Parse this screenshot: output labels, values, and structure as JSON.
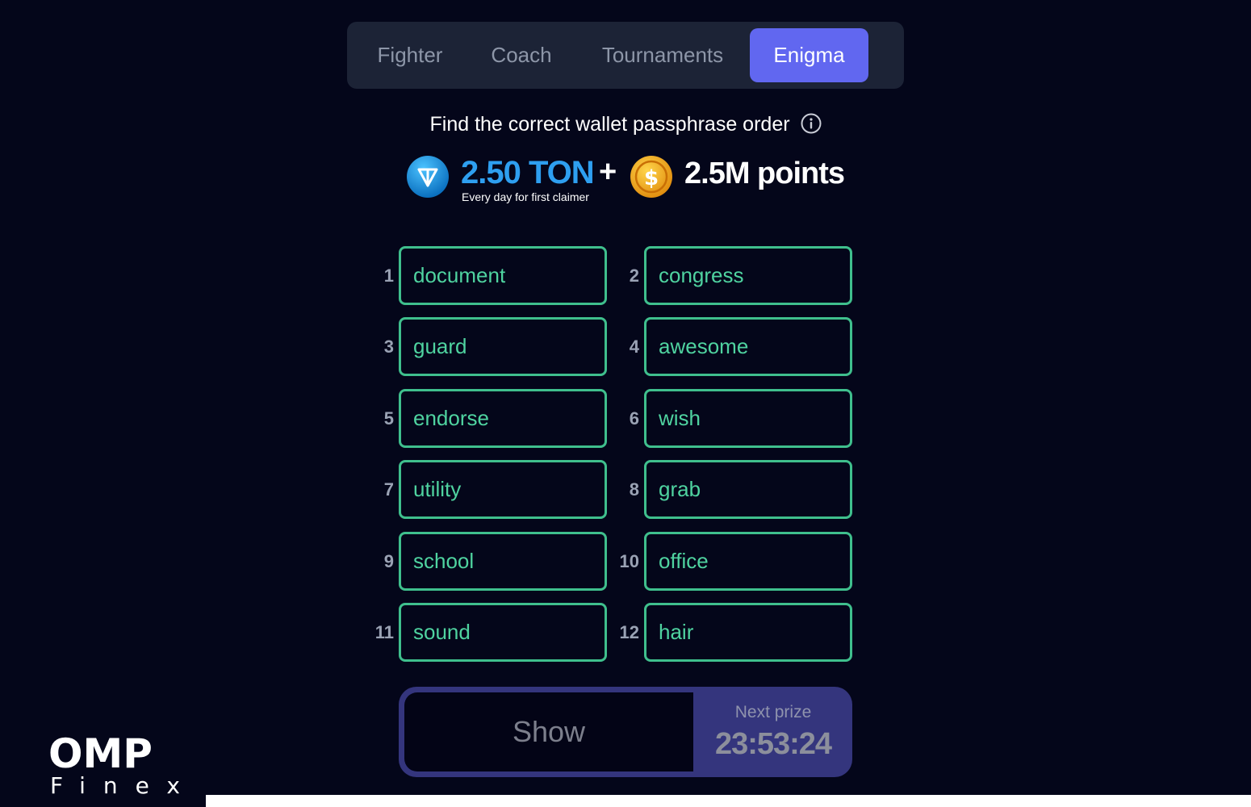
{
  "tabs": {
    "items": [
      {
        "label": "Fighter"
      },
      {
        "label": "Coach"
      },
      {
        "label": "Tournaments"
      },
      {
        "label": "Enigma"
      }
    ],
    "active": "Enigma",
    "active_color": "#6167f0"
  },
  "header": {
    "instruction": "Find the correct wallet passphrase order",
    "info_icon": "info-icon"
  },
  "prize": {
    "ton_icon": "ton-diamond-icon",
    "ton_amount": "2.50 TON",
    "ton_caption": "Every day for first claimer",
    "plus": "+",
    "coin_icon": "dollar-coin-icon",
    "points": "2.5M points",
    "ton_color": "#2e9ff0"
  },
  "words": [
    {
      "num": "1",
      "word": "document"
    },
    {
      "num": "2",
      "word": "congress"
    },
    {
      "num": "3",
      "word": "guard"
    },
    {
      "num": "4",
      "word": "awesome"
    },
    {
      "num": "5",
      "word": "endorse"
    },
    {
      "num": "6",
      "word": "wish"
    },
    {
      "num": "7",
      "word": "utility"
    },
    {
      "num": "8",
      "word": "grab"
    },
    {
      "num": "9",
      "word": "school"
    },
    {
      "num": "10",
      "word": "office"
    },
    {
      "num": "11",
      "word": "sound"
    },
    {
      "num": "12",
      "word": "hair"
    }
  ],
  "word_border_color": "#3fbf8d",
  "action": {
    "show_label": "Show",
    "next_prize_label": "Next prize",
    "next_prize_timer": "23:53:24"
  },
  "watermark": {
    "main": "OMP",
    "sub": "Finex"
  }
}
